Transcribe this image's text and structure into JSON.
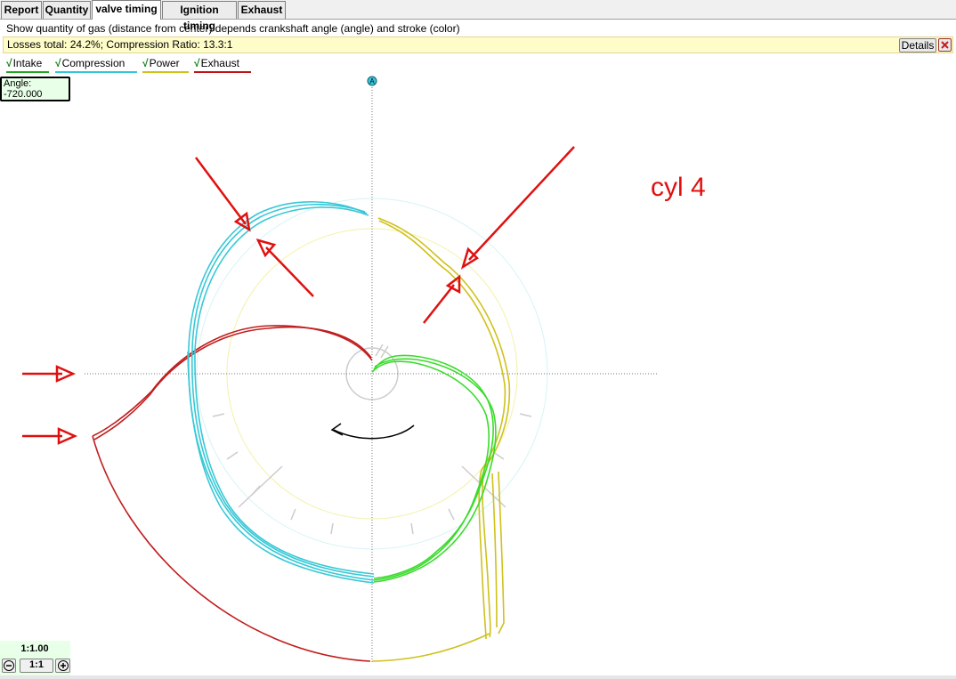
{
  "tabs": [
    {
      "label": "Report"
    },
    {
      "label": "Quantity"
    },
    {
      "label": "valve timing",
      "active": true
    },
    {
      "label": "Ignition timing"
    },
    {
      "label": "Exhaust"
    }
  ],
  "description": "Show quantity of gas (distance from center) depends crankshaft angle (angle) and stroke (color)",
  "infobar": {
    "text": "Losses total: 24.2%;   Compression Ratio: 13.3:1",
    "details_label": "Details"
  },
  "legend": [
    {
      "label": "Intake",
      "color": "#1fa81f",
      "checked": true
    },
    {
      "label": "Compression",
      "color": "#32c6d8",
      "checked": true
    },
    {
      "label": "Power",
      "color": "#d2c21a",
      "checked": true
    },
    {
      "label": "Exhaust",
      "color": "#c01414",
      "checked": true
    }
  ],
  "angle": {
    "label": "Angle:",
    "value": "-720.000"
  },
  "zoom": {
    "label": "1:1.00",
    "reset_label": "1:1",
    "minus_icon": "zoom-out-icon",
    "plus_icon": "zoom-in-icon"
  },
  "plot": {
    "marker_label": "A",
    "annotation": "cyl 4",
    "colors": {
      "intake": "#3adb2c",
      "compression": "#38c8d6",
      "power": "#cfc11c",
      "exhaust": "#c01e1e",
      "annotation": "#e01010"
    }
  }
}
